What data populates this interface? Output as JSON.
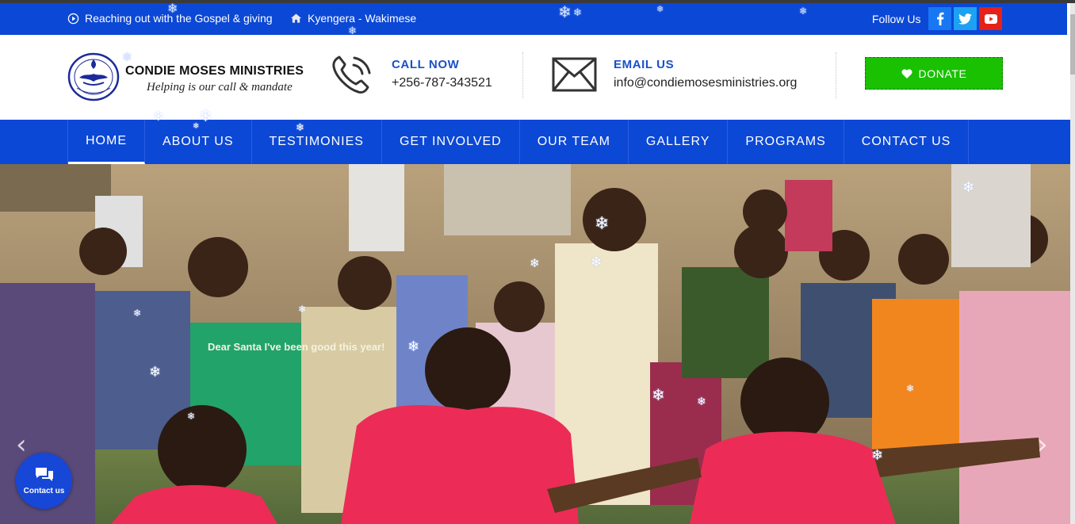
{
  "topbar": {
    "tagline": "Reaching out with the Gospel & giving",
    "location": "Kyengera - Wakimese",
    "follow_label": "Follow Us",
    "socials": [
      "facebook-icon",
      "twitter-icon",
      "youtube-icon"
    ]
  },
  "brand": {
    "name": "CONDIE MOSES MINISTRIES",
    "tagline": "Helping is our call & mandate"
  },
  "contact": {
    "call_label": "CALL NOW",
    "call_value": "+256-787-343521",
    "email_label": "EMAIL US",
    "email_value": "info@condiemosesministries.org"
  },
  "donate_label": "DONATE",
  "nav": {
    "items": [
      {
        "label": "HOME"
      },
      {
        "label": "ABOUT US"
      },
      {
        "label": "TESTIMONIES"
      },
      {
        "label": "GET INVOLVED"
      },
      {
        "label": "OUR TEAM"
      },
      {
        "label": "GALLERY"
      },
      {
        "label": "PROGRAMS"
      },
      {
        "label": "CONTACT US"
      }
    ]
  },
  "hero": {
    "shirt_text": "Dear Santa I've been good this year!"
  },
  "chat": {
    "label": "Contact us"
  },
  "colors": {
    "brand_blue": "#0b48d6",
    "donate_green": "#19c100",
    "facebook": "#1877f2",
    "twitter": "#1da1f2",
    "youtube": "#e62117"
  }
}
